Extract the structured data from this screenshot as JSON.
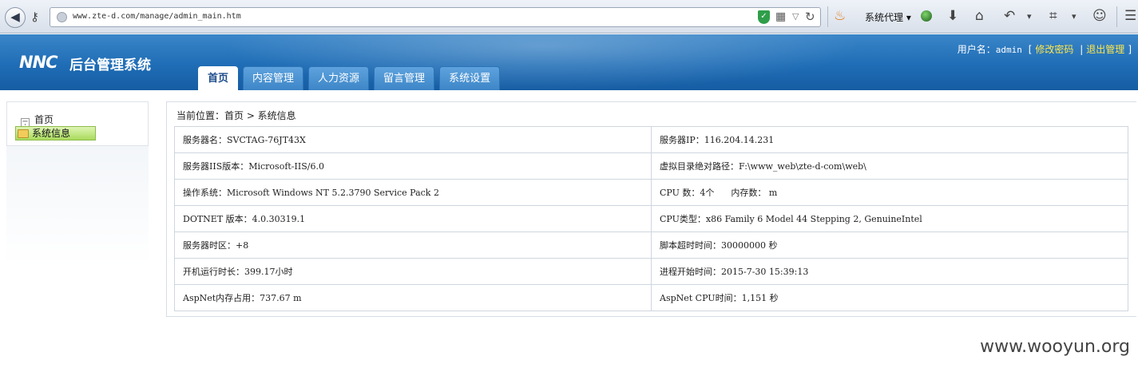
{
  "browser": {
    "url": "www.zte-d.com/manage/admin_main.htm",
    "proxy_label": "系统代理",
    "back_icon": "arrow-left-icon",
    "shield_glyph": "✓"
  },
  "header": {
    "logo_mark": "NNC",
    "logo_title": "后台管理系统",
    "user_label": "用户名：",
    "user_name": "admin",
    "change_password": "修改密码",
    "separator": "|",
    "logout": "退出管理",
    "bracket_open": "[",
    "bracket_close": "]"
  },
  "nav": {
    "tabs": [
      {
        "label": "首页"
      },
      {
        "label": "内容管理"
      },
      {
        "label": "人力资源"
      },
      {
        "label": "留言管理"
      },
      {
        "label": "系统设置"
      }
    ]
  },
  "sidebar": {
    "root": "首页",
    "item": "系统信息"
  },
  "main": {
    "breadcrumb": "当前位置：首页 > 系统信息",
    "rows": [
      {
        "left": "服务器名：SVCTAG-76JT43X",
        "right": "服务器IP：116.204.14.231"
      },
      {
        "left": "服务器IIS版本：Microsoft-IIS/6.0",
        "right": "虚拟目录绝对路径：F:\\www_web\\zte-d-com\\web\\"
      },
      {
        "left": "操作系统：Microsoft Windows NT 5.2.3790 Service Pack 2",
        "right": "CPU 数：4个      内存数： m"
      },
      {
        "left": "DOTNET 版本：4.0.30319.1",
        "right": "CPU类型：x86 Family 6 Model 44 Stepping 2, GenuineIntel"
      },
      {
        "left": "服务器时区：+8",
        "right": "脚本超时时间：30000000 秒"
      },
      {
        "left": "开机运行时长：399.17小时",
        "right": "进程开始时间：2015-7-30 15:39:13"
      },
      {
        "left": "AspNet内存占用：737.67 m",
        "right": "AspNet CPU时间：1,151 秒"
      }
    ]
  },
  "watermark": "www.wooyun.org",
  "colors": {
    "header_blue": "#1f6db6",
    "link_yellow": "#ffe74a",
    "tree_green": "#a9db5c"
  }
}
